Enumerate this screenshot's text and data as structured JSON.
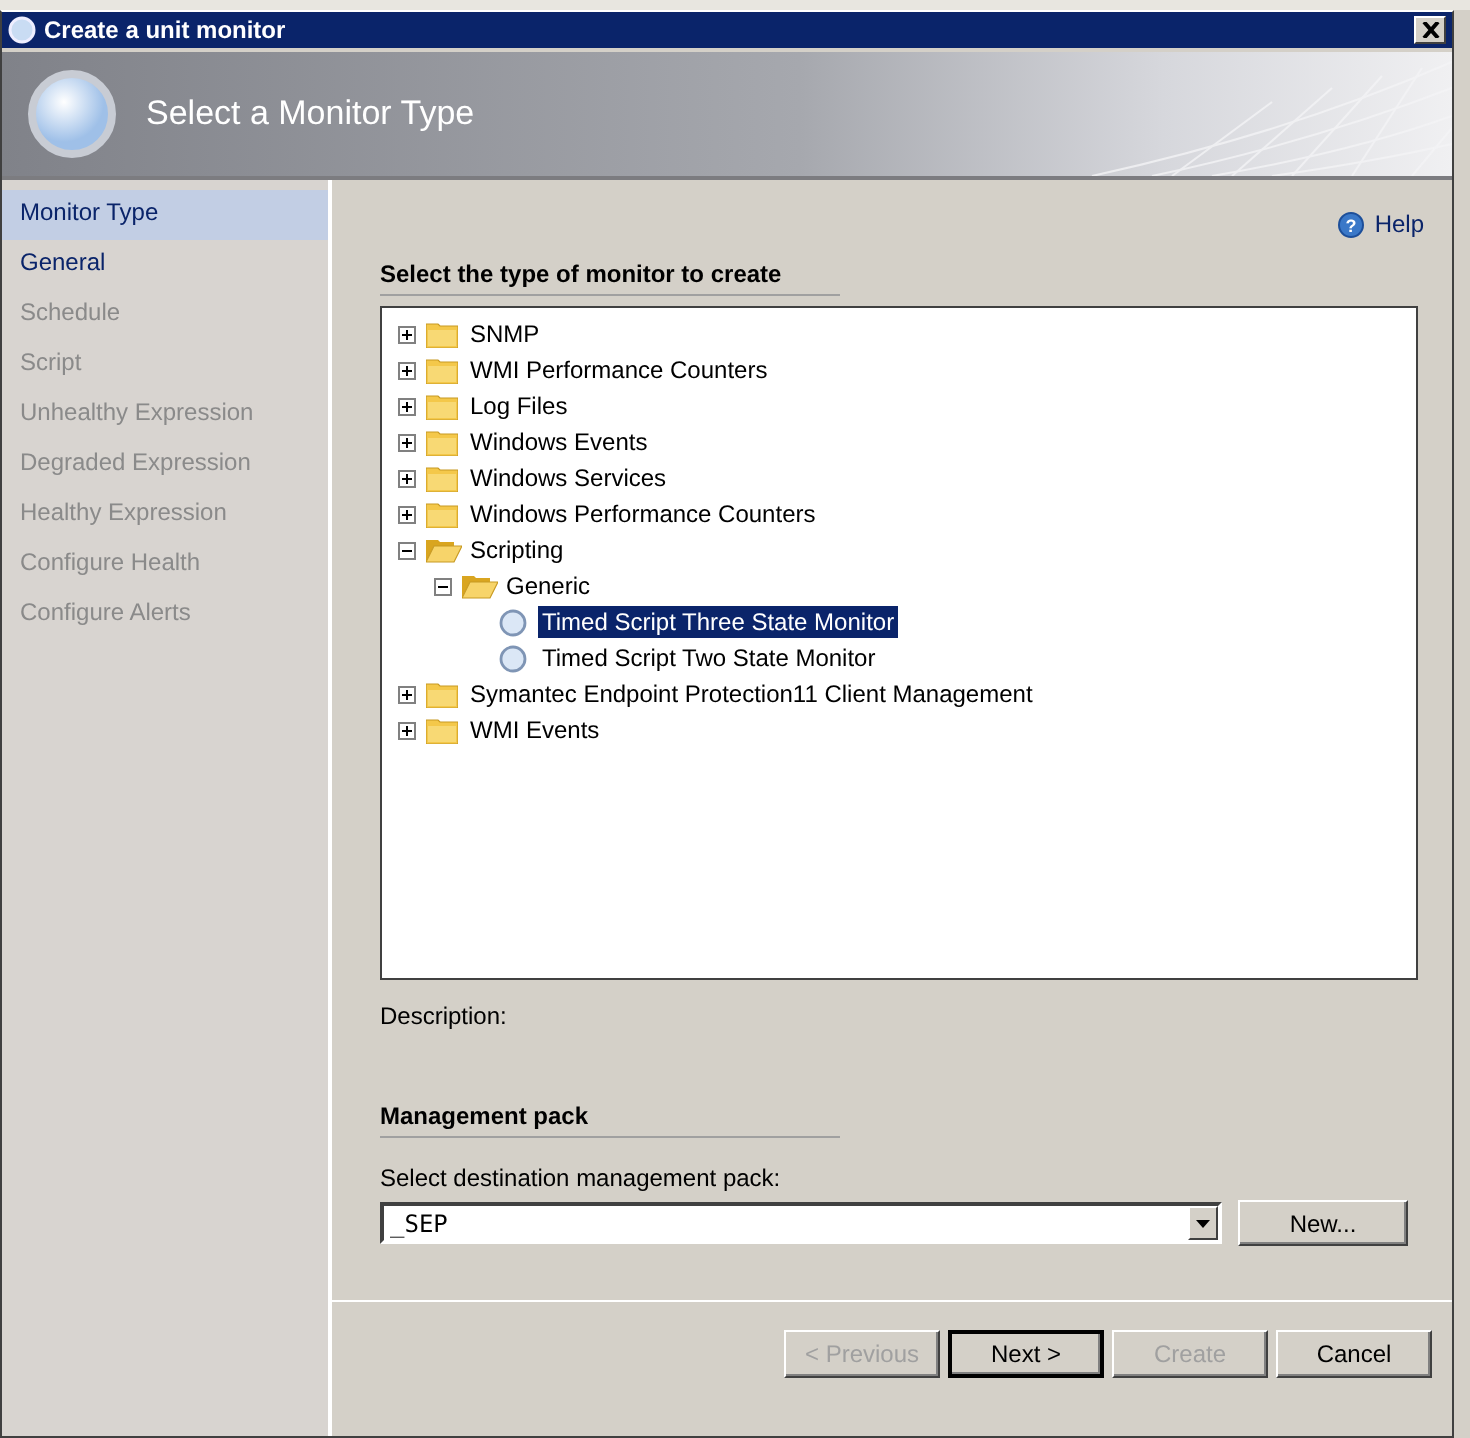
{
  "window": {
    "title": "Create a unit monitor"
  },
  "header": {
    "title": "Select a Monitor Type"
  },
  "sidebar": {
    "items": [
      {
        "label": "Monitor Type",
        "selected": true,
        "disabled": false
      },
      {
        "label": "General",
        "selected": false,
        "disabled": false
      },
      {
        "label": "Schedule",
        "selected": false,
        "disabled": true
      },
      {
        "label": "Script",
        "selected": false,
        "disabled": true
      },
      {
        "label": "Unhealthy Expression",
        "selected": false,
        "disabled": true
      },
      {
        "label": "Degraded Expression",
        "selected": false,
        "disabled": true
      },
      {
        "label": "Healthy Expression",
        "selected": false,
        "disabled": true
      },
      {
        "label": "Configure Health",
        "selected": false,
        "disabled": true
      },
      {
        "label": "Configure Alerts",
        "selected": false,
        "disabled": true
      }
    ]
  },
  "help": {
    "icon": "?",
    "label": "Help"
  },
  "section_title": "Select the type of monitor to create",
  "tree": {
    "items": [
      {
        "label": "SNMP",
        "kind": "folder",
        "expanded": false,
        "selected": false
      },
      {
        "label": "WMI Performance Counters",
        "kind": "folder",
        "expanded": false,
        "selected": false
      },
      {
        "label": "Log Files",
        "kind": "folder",
        "expanded": false,
        "selected": false
      },
      {
        "label": "Windows Events",
        "kind": "folder",
        "expanded": false,
        "selected": false
      },
      {
        "label": "Windows Services",
        "kind": "folder",
        "expanded": false,
        "selected": false
      },
      {
        "label": "Windows Performance Counters",
        "kind": "folder",
        "expanded": false,
        "selected": false
      },
      {
        "label": "Scripting",
        "kind": "folder",
        "expanded": true,
        "selected": false,
        "children": [
          {
            "label": "Generic",
            "kind": "folder",
            "expanded": true,
            "selected": false,
            "children": [
              {
                "label": "Timed Script Three State Monitor",
                "kind": "monitor",
                "selected": true
              },
              {
                "label": "Timed Script Two State Monitor",
                "kind": "monitor",
                "selected": false
              }
            ]
          }
        ]
      },
      {
        "label": "Symantec Endpoint Protection11 Client Management",
        "kind": "folder",
        "expanded": false,
        "selected": false
      },
      {
        "label": "WMI Events",
        "kind": "folder",
        "expanded": false,
        "selected": false
      }
    ]
  },
  "description": {
    "label": "Description:"
  },
  "management_pack": {
    "title": "Management pack",
    "label": "Select destination management pack:",
    "value": "_SEP",
    "new_button": "New..."
  },
  "buttons": [
    {
      "label": "< Previous",
      "disabled": true,
      "default": false
    },
    {
      "label": "Next >",
      "disabled": false,
      "default": true
    },
    {
      "label": "Create",
      "disabled": true,
      "default": false
    },
    {
      "label": "Cancel",
      "disabled": false,
      "default": false
    }
  ]
}
